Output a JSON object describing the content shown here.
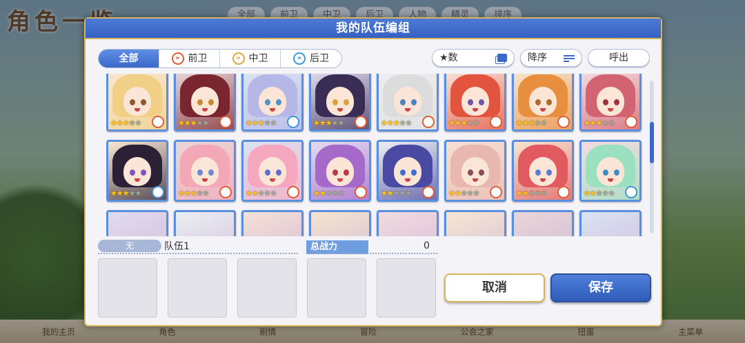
{
  "background": {
    "title": "角色一览",
    "tabs": [
      "全部",
      "前卫",
      "中卫",
      "后卫",
      "人物",
      "精灵",
      "排序"
    ],
    "footer": [
      "我的主页",
      "角色",
      "剧情",
      "冒险",
      "公会之家",
      "扭蛋",
      "主菜单"
    ]
  },
  "dialog": {
    "title": "我的队伍编组",
    "filters": [
      {
        "label": "全部",
        "active": true,
        "badge": ""
      },
      {
        "label": "前卫",
        "active": false,
        "badge": "front"
      },
      {
        "label": "中卫",
        "active": false,
        "badge": "mid"
      },
      {
        "label": "后卫",
        "active": false,
        "badge": "back"
      }
    ],
    "stars_button": "★数",
    "sort_button": "降序",
    "call_button": "呼出",
    "party": {
      "role_label": "无",
      "name": "队伍1",
      "power_label": "总战力",
      "power_value": "0"
    },
    "cancel_button": "取消",
    "save_button": "保存"
  },
  "characters": [
    {
      "hair": "#f2cf86",
      "eye": "#8a5a2e",
      "stars": 3,
      "pos": "front"
    },
    {
      "hair": "#7a2630",
      "eye": "#c98a2e",
      "stars": 3,
      "pos": "front"
    },
    {
      "hair": "#b5b7e6",
      "eye": "#4d93c9",
      "stars": 3,
      "pos": "back"
    },
    {
      "hair": "#3a2d55",
      "eye": "#d6a43a",
      "stars": 3,
      "pos": "front"
    },
    {
      "hair": "#dcdcdc",
      "eye": "#4d7fc2",
      "stars": 3,
      "pos": "front"
    },
    {
      "hair": "#e2543e",
      "eye": "#6f56b3",
      "stars": 3,
      "pos": "front"
    },
    {
      "hair": "#e88e3f",
      "eye": "#b06a2e",
      "stars": 3,
      "pos": "front"
    },
    {
      "hair": "#d16470",
      "eye": "#9a3540",
      "stars": 3,
      "pos": "front"
    },
    {
      "hair": "#2b2035",
      "eye": "#7a57b8",
      "stars": 3,
      "pos": "back"
    },
    {
      "hair": "#f2a8b6",
      "eye": "#6a8ad6",
      "stars": 3,
      "pos": "front"
    },
    {
      "hair": "#f5a7c0",
      "eye": "#5a6fd0",
      "stars": 2,
      "pos": "front"
    },
    {
      "hair": "#a469c9",
      "eye": "#b53a4a",
      "stars": 2,
      "pos": "front"
    },
    {
      "hair": "#4a4aa3",
      "eye": "#3d6fd0",
      "stars": 2,
      "pos": "front"
    },
    {
      "hair": "#e8b8b0",
      "eye": "#8a4a5a",
      "stars": 2,
      "pos": "front"
    },
    {
      "hair": "#e05a60",
      "eye": "#5a7bd0",
      "stars": 2,
      "pos": "front"
    },
    {
      "hair": "#9be0c0",
      "eye": "#3a8fc0",
      "stars": 2,
      "pos": "back"
    }
  ],
  "colors": {
    "accent": "#3b69c9",
    "gold": "#d8b55a",
    "header": "#4070cc"
  }
}
